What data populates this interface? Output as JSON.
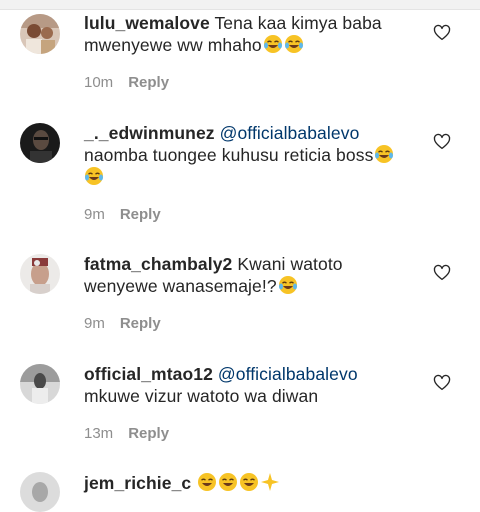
{
  "comments": [
    {
      "username": "lulu_wemalove",
      "mention": "",
      "text": "Tena kaa kimya baba mwenyewe ww mhaho",
      "emojis": [
        "laughing-tears",
        "laughing-tears"
      ],
      "time": "10m",
      "reply_label": "Reply"
    },
    {
      "username": "_._edwinmunez",
      "mention": "@officialbabalevo",
      "text": "naomba tuongee kuhusu reticia boss",
      "emojis": [
        "laughing-tears",
        "laughing-tears"
      ],
      "time": "9m",
      "reply_label": "Reply"
    },
    {
      "username": "fatma_chambaly2",
      "mention": "",
      "text": "Kwani watoto wenyewe wanasemaje!?",
      "emojis": [
        "laughing-tears"
      ],
      "time": "9m",
      "reply_label": "Reply"
    },
    {
      "username": "official_mtao12",
      "mention": "@officialbabalevo",
      "text": "mkuwe vizur watoto wa diwan",
      "emojis": [],
      "time": "13m",
      "reply_label": "Reply"
    },
    {
      "username": "jem_richie_c",
      "mention": "",
      "text": "",
      "emojis": [
        "laughing-tears",
        "laughing-tears",
        "laughing-tears",
        "sparkles"
      ],
      "time": "",
      "reply_label": ""
    }
  ],
  "colors": {
    "text": "#262626",
    "mention": "#00376b",
    "meta": "#8e8e8e",
    "background": "#ffffff"
  },
  "icons": {
    "like": "heart-outline-icon",
    "emoji": "face-with-tears-of-joy"
  }
}
